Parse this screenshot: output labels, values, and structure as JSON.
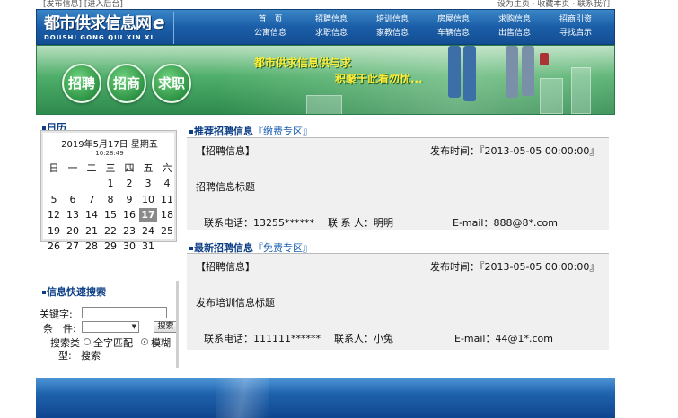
{
  "topbar": {
    "left_links": [
      "[发布信息]",
      "[进入后台]"
    ],
    "right_text": "设为主页 · 收藏本页 · 联系我们"
  },
  "logo": {
    "main": "都市供求信息网",
    "suffix": "e",
    "sub": "DOUSHI GONG QIU XIN XI"
  },
  "nav": {
    "row1": [
      "首　页",
      "招聘信息",
      "培训信息",
      "房屋信息",
      "求购信息",
      "招商引资"
    ],
    "row2": [
      "公寓信息",
      "求职信息",
      "家教信息",
      "车辆信息",
      "出售信息",
      "寻找启示"
    ]
  },
  "banner": {
    "buttons": [
      "招聘",
      "招商",
      "求职"
    ],
    "slogan_line1": "都市供求信息供与求",
    "slogan_line2": "积聚于此看勿忧..."
  },
  "calendar": {
    "title": "日历",
    "date": "2019年5月17日 星期五",
    "time": "10:28:49",
    "weekdays": [
      "日",
      "一",
      "二",
      "三",
      "四",
      "五",
      "六"
    ],
    "weeks": [
      [
        "",
        "",
        "",
        "1",
        "2",
        "3",
        "4"
      ],
      [
        "5",
        "6",
        "7",
        "8",
        "9",
        "10",
        "11"
      ],
      [
        "12",
        "13",
        "14",
        "15",
        "16",
        "17",
        "18"
      ],
      [
        "19",
        "20",
        "21",
        "22",
        "23",
        "24",
        "25"
      ],
      [
        "26",
        "27",
        "28",
        "29",
        "30",
        "31",
        ""
      ]
    ],
    "today": "17"
  },
  "search": {
    "title": "信息快速搜索",
    "keyword_label": "关键字:",
    "keyword_value": "",
    "condition_label": "条　件:",
    "condition_value": "",
    "search_button": "搜索",
    "type_label_1": "搜索类",
    "type_label_2": "型:",
    "type_exact": "全字匹配",
    "type_fuzzy": "模糊",
    "type_fuzzy_2": "搜索"
  },
  "recommend": {
    "title": "推荐招聘信息",
    "tag": "『缴费专区』",
    "category": "【招聘信息】",
    "publish_time": "发布时间：『2013-05-05 00:00:00』",
    "headline": "招聘信息标题",
    "phone": "联系电话：13255******",
    "contact": "联 系 人：明明",
    "email": "E-mail：888@8*.com"
  },
  "latest": {
    "title": "最新招聘信息",
    "tag": "『免费专区』",
    "category": "【招聘信息】",
    "publish_time": "发布时间：『2013-05-05 00:00:00』",
    "headline": "发布培训信息标题",
    "phone": "联系电话：111111******",
    "contact": "联系人：小兔",
    "email": "E-mail：44@1*.com"
  }
}
